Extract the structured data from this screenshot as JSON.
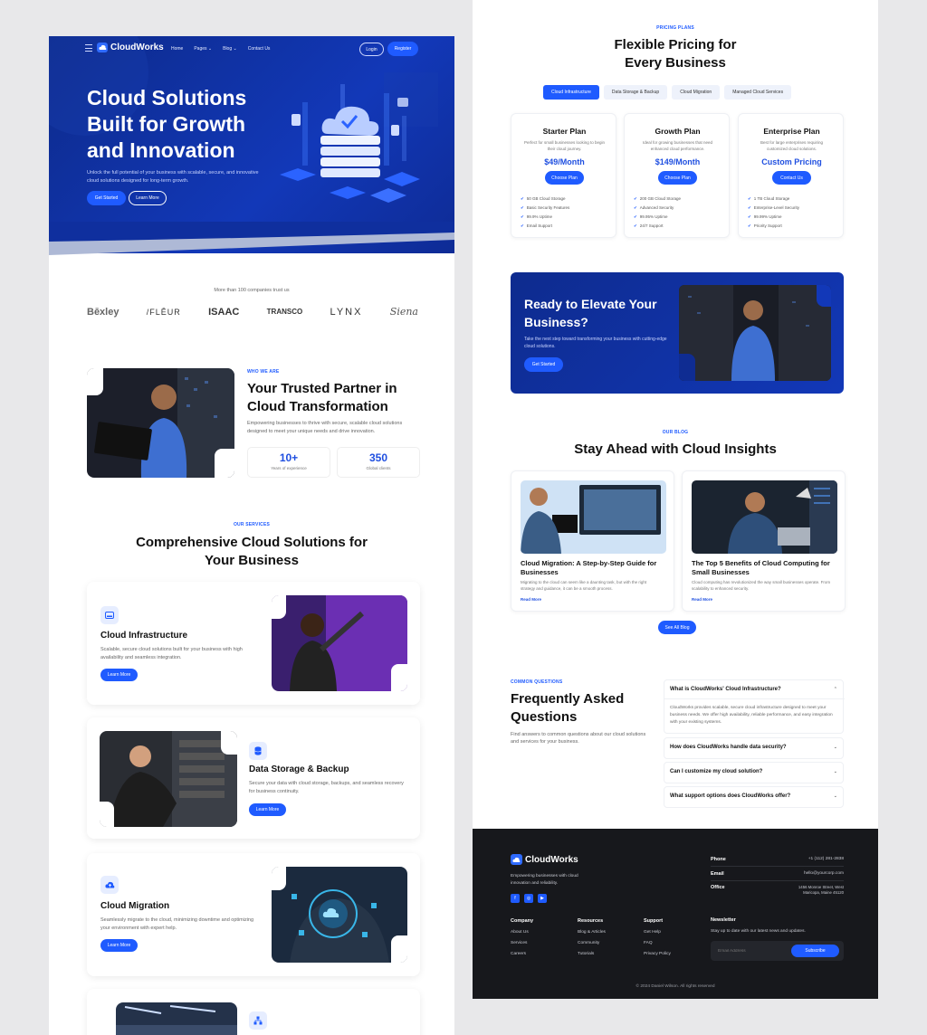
{
  "nav": {
    "brand": "CloudWorks",
    "links": [
      "Home",
      "Pages ⌄",
      "Blog ⌄",
      "Contact Us"
    ],
    "login": "Login",
    "register": "Register"
  },
  "hero": {
    "title": "Cloud Solutions Built for Growth and Innovation",
    "desc": "Unlock the full potential of your business with scalable, secure, and innovative cloud solutions designed for long-term growth.",
    "cta1": "Get Started",
    "cta2": "Learn More"
  },
  "trust": {
    "text": "More than 100 companies trust us",
    "logos": [
      "Bēxley",
      "/FLĒUR",
      "ISAAC",
      "TRANSCO",
      "LYNX",
      "Siena"
    ]
  },
  "about": {
    "eyebrow": "WHO WE ARE",
    "title": "Your Trusted Partner in Cloud Transformation",
    "desc": "Empowering businesses to thrive with secure, scalable cloud solutions designed to meet your unique needs and drive innovation.",
    "stats": [
      {
        "value": "10+",
        "label": "Years of experience"
      },
      {
        "value": "350",
        "label": "Global clients"
      }
    ]
  },
  "services": {
    "eyebrow": "OUR SERVICES",
    "title": "Comprehensive Cloud Solutions for Your Business",
    "learn": "Learn More",
    "items": [
      {
        "title": "Cloud Infrastructure",
        "desc": "Scalable, secure cloud solutions built for your business with high availability and seamless integration."
      },
      {
        "title": "Data Storage & Backup",
        "desc": "Secure your data with cloud storage, backups, and seamless recovery for business continuity."
      },
      {
        "title": "Cloud Migration",
        "desc": "Seamlessly migrate to the cloud, minimizing downtime and optimizing your environment with expert help."
      }
    ]
  },
  "pricing": {
    "eyebrow": "PRICING PLANS",
    "title": "Flexible Pricing for Every Business",
    "tabs": [
      "Cloud Infrastructure",
      "Data Storage & Backup",
      "Cloud Migration",
      "Managed Cloud Services"
    ],
    "choose": "Choose Plan",
    "contact": "Contact Us",
    "plans": [
      {
        "name": "Starter Plan",
        "desc": "Perfect for small businesses looking to begin their cloud journey.",
        "price": "$49/Month",
        "features": [
          "50 GB Cloud Storage",
          "Basic Security Features",
          "99.9% Uptime",
          "Email Support"
        ]
      },
      {
        "name": "Growth Plan",
        "desc": "Ideal for growing businesses that need enhanced cloud performance.",
        "price": "$149/Month",
        "features": [
          "200 GB Cloud Storage",
          "Advanced Security",
          "99.95% Uptime",
          "24/7 Support"
        ]
      },
      {
        "name": "Enterprise Plan",
        "desc": "Best for large enterprises requiring customized cloud solutions.",
        "price": "Custom Pricing",
        "features": [
          "1 TB Cloud Storage",
          "Enterprise-Level Security",
          "99.99% Uptime",
          "Priority Support"
        ]
      }
    ]
  },
  "cta": {
    "title": "Ready to Elevate Your Business?",
    "desc": "Take the next step toward transforming your business with cutting-edge cloud solutions.",
    "button": "Get Started"
  },
  "blog": {
    "eyebrow": "OUR BLOG",
    "title": "Stay Ahead with Cloud Insights",
    "read": "Read More",
    "see_all": "See All Blog",
    "posts": [
      {
        "title": "Cloud Migration: A Step-by-Step Guide for Businesses",
        "desc": "Migrating to the cloud can seem like a daunting task, but with the right strategy and guidance, it can be a smooth process."
      },
      {
        "title": "The Top 5 Benefits of Cloud Computing for Small Businesses",
        "desc": "Cloud computing has revolutionized the way small businesses operate. From scalability to enhanced security."
      }
    ]
  },
  "faq": {
    "eyebrow": "COMMON QUESTIONS",
    "title": "Frequently Asked Questions",
    "desc": "Find answers to common questions about our cloud solutions and services for your business.",
    "items": [
      {
        "q": "What is CloudWorks' Cloud Infrastructure?",
        "a": "CloudWorks provides scalable, secure cloud infrastructure designed to meet your business needs. We offer high availability, reliable performance, and easy integration with your existing systems."
      },
      {
        "q": "How does CloudWorks handle data security?"
      },
      {
        "q": "Can I customize my cloud solution?"
      },
      {
        "q": "What support options does CloudWorks offer?"
      }
    ]
  },
  "footer": {
    "brand": "CloudWorks",
    "tagline": "Empowering businesses with cloud innovation and reliability.",
    "cols": [
      {
        "head": "Company",
        "links": [
          "About Us",
          "Services",
          "Careers"
        ]
      },
      {
        "head": "Resources",
        "links": [
          "Blog & Articles",
          "Community",
          "Tutorials"
        ]
      },
      {
        "head": "Support",
        "links": [
          "Get Help",
          "FAQ",
          "Privacy Policy"
        ]
      }
    ],
    "contact": [
      {
        "label": "Phone",
        "value": "+1 (112) 281-2838"
      },
      {
        "label": "Email",
        "value": "hello@yourcorp.com"
      },
      {
        "label": "Office",
        "value": "1456 Monroe Street, West Maricopa, Maine 45120"
      }
    ],
    "newsletter": {
      "head": "Newsletter",
      "desc": "Stay up to date with our latest news and updates.",
      "placeholder": "Email Address",
      "button": "Subscribe"
    },
    "copyright": "© 2024 Daniel Wilson. All rights reserved"
  },
  "colors": {
    "accent": "#1f5bff",
    "hero": "#1238b8",
    "footer": "#17181c"
  }
}
